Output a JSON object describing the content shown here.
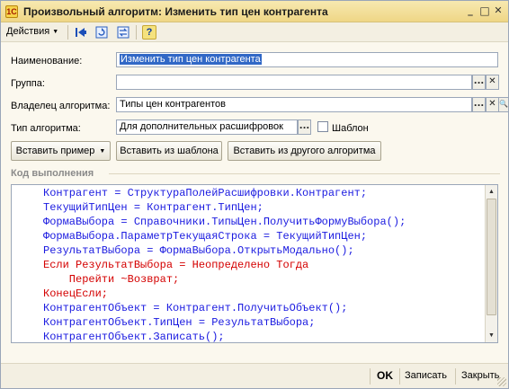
{
  "window": {
    "title": "Произвольный алгоритм: Изменить тип цен контрагента",
    "app_icon": "1С",
    "minimize": "_",
    "maximize": "□",
    "close": "✕"
  },
  "toolbar": {
    "actions_label": "Действия",
    "help_label": "?",
    "icons": [
      "arrow-left-icon",
      "refresh-icon",
      "arrows-icon",
      "help-icon"
    ]
  },
  "form": {
    "name_label": "Наименование:",
    "name_value": "Изменить тип цен контрагента",
    "group_label": "Группа:",
    "group_value": "",
    "owner_label": "Владелец алгоритма:",
    "owner_value": "Типы цен контрагентов",
    "type_label": "Тип алгоритма:",
    "type_value": "Для дополнительных расшифровок",
    "template_label": "Шаблон",
    "template_checked": false,
    "select_btn": "...",
    "clear_btn": "✕",
    "open_btn": "🔍"
  },
  "buttons": {
    "insert_example": "Вставить пример",
    "insert_from_template": "Вставить из шаблона",
    "insert_from_other": "Вставить из другого алгоритма"
  },
  "code_section": {
    "title": "Код выполнения",
    "lines": [
      {
        "text": "Контрагент = СтруктураПолейРасшифровки.Контрагент;",
        "color": "#1a1ae0"
      },
      {
        "text": "ТекущийТипЦен = Контрагент.ТипЦен;",
        "color": "#1a1ae0"
      },
      {
        "text": "ФормаВыбора = Справочники.ТипыЦен.ПолучитьФормуВыбора();",
        "color": "#1a1ae0"
      },
      {
        "text": "ФормаВыбора.ПараметрТекущаяСтрока = ТекущийТипЦен;",
        "color": "#1a1ae0"
      },
      {
        "text": "РезультатВыбора = ФормаВыбора.ОткрытьМодально();",
        "color": "#1a1ae0"
      },
      {
        "text": "Если РезультатВыбора = Неопределено Тогда",
        "color": "#d40000"
      },
      {
        "text": "    Перейти ~Возврат;",
        "color": "#d40000"
      },
      {
        "text": "КонецЕсли;",
        "color": "#d40000"
      },
      {
        "text": "КонтрагентОбъект = Контрагент.ПолучитьОбъект();",
        "color": "#1a1ae0"
      },
      {
        "text": "КонтрагентОбъект.ТипЦен = РезультатВыбора;",
        "color": "#1a1ae0"
      },
      {
        "text": "КонтрагентОбъект.Записать();",
        "color": "#1a1ae0"
      }
    ]
  },
  "bottom": {
    "ok": "OK",
    "save": "Записать",
    "close": "Закрыть"
  }
}
